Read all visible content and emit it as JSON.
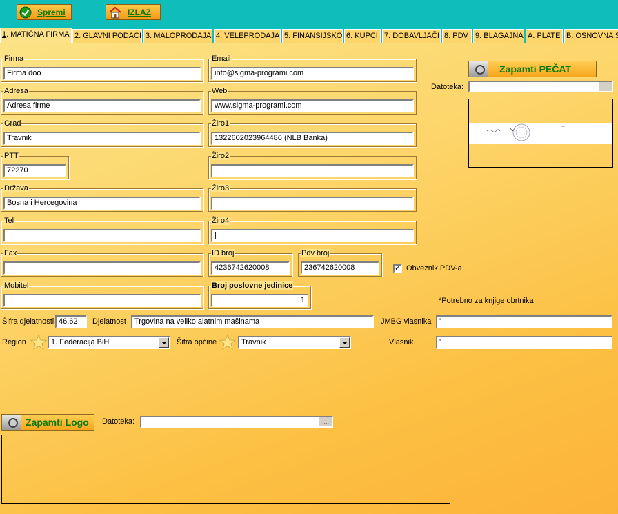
{
  "toolbar": {
    "save_label": "Spremi",
    "exit_label": "IZLAZ"
  },
  "tabs": [
    {
      "key": "1",
      "label": ". MATIČNA FIRMA"
    },
    {
      "key": "2",
      "label": ". GLAVNI PODACI"
    },
    {
      "key": "3",
      "label": ". MALOPRODAJA"
    },
    {
      "key": "4",
      "label": ". VELEPRODAJA"
    },
    {
      "key": "5",
      "label": ". FINANSIJSKO"
    },
    {
      "key": "6",
      "label": ". KUPCI"
    },
    {
      "key": "7",
      "label": ". DOBAVLJAČI"
    },
    {
      "key": "8",
      "label": ". PDV"
    },
    {
      "key": "9",
      "label": ". BLAGAJNA"
    },
    {
      "key": "A",
      "label": ". PLATE"
    },
    {
      "key": "B",
      "label": ". OSNOVNA S"
    }
  ],
  "fields": {
    "firma": {
      "label": "Firma",
      "value": "Firma doo"
    },
    "email": {
      "label": "Email",
      "value": "info@sigma-programi.com"
    },
    "adresa": {
      "label": "Adresa",
      "value": "Adresa firme"
    },
    "web": {
      "label": "Web",
      "value": "www.sigma-programi.com"
    },
    "grad": {
      "label": "Grad",
      "value": "Travnik"
    },
    "ziro1": {
      "label": "Žiro1",
      "value": "1322602023964486 (NLB Banka)"
    },
    "ptt": {
      "label": "PTT",
      "value": "72270"
    },
    "ziro2": {
      "label": "Žiro2",
      "value": ""
    },
    "drzava": {
      "label": "Država",
      "value": "Bosna i Hercegovina"
    },
    "ziro3": {
      "label": "Žiro3",
      "value": ""
    },
    "tel": {
      "label": "Tel",
      "value": ""
    },
    "ziro4": {
      "label": "Žiro4",
      "value": "|"
    },
    "fax": {
      "label": "Fax",
      "value": ""
    },
    "id_broj": {
      "label": "ID broj",
      "value": "4236742620008"
    },
    "pdv_broj": {
      "label": "Pdv broj",
      "value": "236742620008"
    },
    "mobitel": {
      "label": "Mobitel",
      "value": ""
    },
    "broj_pj": {
      "label": "Broj poslovne jedinice",
      "value": "1"
    }
  },
  "pdv_checkbox": {
    "label": "Obveznik PDV-a",
    "mark": "✓"
  },
  "obrtnik_note": "*Potrebno za knjige obrtnika",
  "sifra_djelatnosti": {
    "label": "Šifra djelatnosti",
    "value": "46.62"
  },
  "djelatnost": {
    "label": "Djelatnost",
    "value": "Trgovina na veliko alatnim mašinama"
  },
  "jmbg": {
    "label": "JMBG vlasnika",
    "value": "'"
  },
  "vlasnik": {
    "label": "Vlasnik",
    "value": "'"
  },
  "region": {
    "label": "Region",
    "value": "1. Federacija BiH"
  },
  "sifra_opcine": {
    "label": "Šifra općine",
    "value": "Travnik"
  },
  "stamp": {
    "button_label": "Zapamti PEČAT",
    "datoteka_label": "Datoteka:",
    "datoteka_value": ""
  },
  "logo": {
    "button_label": "Zapamti Logo",
    "datoteka_label": "Datoteka:",
    "datoteka_value": ""
  },
  "browse_glyph": "....",
  "colors": {
    "toolbar_bg": "#0fbdbb",
    "button_text": "#0a7a0a"
  }
}
